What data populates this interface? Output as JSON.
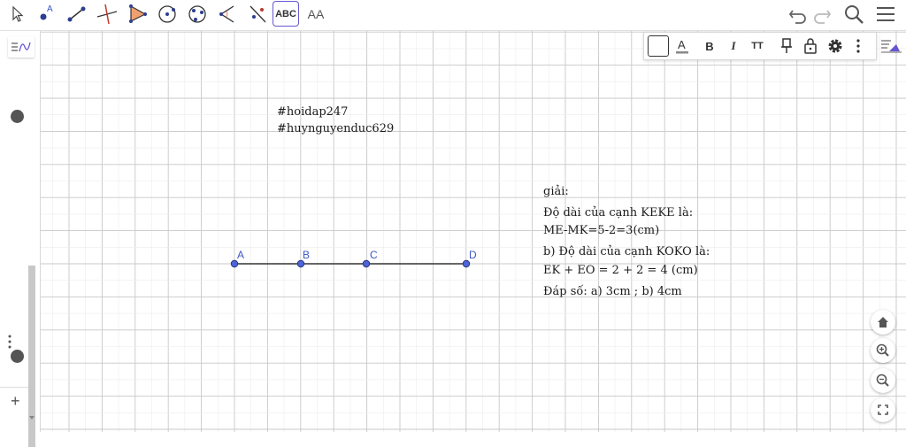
{
  "toolbar": {
    "tools": [
      {
        "name": "move-tool",
        "icon": "arrow-pointer-icon"
      },
      {
        "name": "point-tool",
        "icon": "point-a-icon",
        "label": "A"
      },
      {
        "name": "segment-tool",
        "icon": "segment-icon"
      },
      {
        "name": "perpendicular-tool",
        "icon": "perpendicular-line-icon"
      },
      {
        "name": "polygon-tool",
        "icon": "triangle-icon"
      },
      {
        "name": "circle-tool",
        "icon": "circle-center-icon"
      },
      {
        "name": "ellipse-tool",
        "icon": "ellipse-icon"
      },
      {
        "name": "angle-tool",
        "icon": "angle-icon"
      },
      {
        "name": "reflect-tool",
        "icon": "reflect-line-icon"
      },
      {
        "name": "text-tool",
        "icon": "abc-text-icon",
        "label": "ABC",
        "active": true
      },
      {
        "name": "slider-tool",
        "icon": "aa-size-icon",
        "label": "AA"
      }
    ],
    "right": [
      "undo-icon",
      "redo-icon",
      "search-icon",
      "menu-icon"
    ]
  },
  "style_bar": {
    "bold": "B",
    "italic": "I",
    "size": "TT"
  },
  "construction": {
    "segment": {
      "points": [
        "A",
        "B",
        "C",
        "D"
      ]
    },
    "text_block_1": [
      "#hoidap247",
      "#huynguyenduc629"
    ],
    "text_block_2": [
      "giải:",
      "Độ dài của cạnh KEKE là:",
      "ME-MK=5-2=3(cm)",
      "b) Độ dài của cạnh KOKO là:",
      "EK + EO = 2 + 2 = 4 (cm)",
      "Đáp số: a) 3cm ; b) 4cm"
    ]
  },
  "left_panel": {
    "add_label": "+"
  },
  "colors": {
    "accent": "#6557d2",
    "point": "#3d57c7",
    "grid_major": "#c8c8c8",
    "grid_minor": "#ececec"
  }
}
